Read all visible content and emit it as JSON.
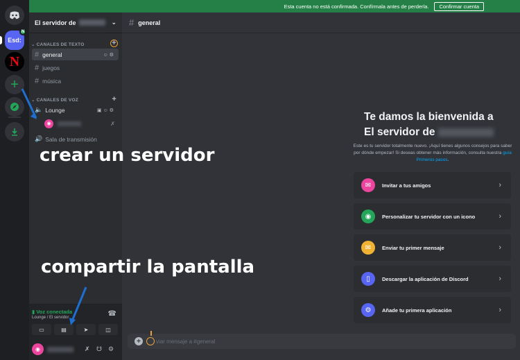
{
  "rail": {
    "esd_label": "Esd:",
    "esd_badge": "N",
    "netflix_label": "N",
    "add_label": "+"
  },
  "banner": {
    "text": "Esta cuenta no está confirmada. Confírmala antes de perderla.",
    "button": "Confirmar cuenta",
    "color": "#248046"
  },
  "sidebar": {
    "server_name": "El servidor de",
    "text_category": "CANALES DE TEXTO",
    "voice_category": "CANALES DE VOZ",
    "text_channels": [
      "general",
      "juegos",
      "música"
    ],
    "voice_channels": [
      "Lounge"
    ],
    "stage_channel": "Sala de transmisión"
  },
  "voice_panel": {
    "status": "Voz conectada",
    "location": "Lounge / El servidor"
  },
  "main": {
    "channel": "general",
    "welcome_line1": "Te damos la bienvenida a",
    "welcome_line2": "El servidor de",
    "welcome_sub": "Este es tu servidor totalmente nuevo. ¡Aquí tienes algunos consejos para saber por dónde empezar! Si deseas obtener más información, consulta nuestra",
    "welcome_link": "guía Primeros pasos",
    "cards": [
      {
        "label": "Invitar a tus amigos",
        "icon": "invite-icon",
        "color": "#eb459e"
      },
      {
        "label": "Personalizar tu servidor con un icono",
        "icon": "globe-icon",
        "color": "#23a55a"
      },
      {
        "label": "Enviar tu primer mensaje",
        "icon": "message-icon",
        "color": "#f0b232"
      },
      {
        "label": "Descargar la aplicación de Discord",
        "icon": "phone-icon",
        "color": "#5865f2"
      },
      {
        "label": "Añade tu primera aplicación",
        "icon": "app-icon",
        "color": "#5865f2"
      }
    ],
    "composer_placeholder": "viar mensaje a #general"
  },
  "annotations": {
    "create_server": "crear un servidor",
    "share_screen": "compartir la pantalla",
    "arrow_color": "#1e6fd0"
  }
}
